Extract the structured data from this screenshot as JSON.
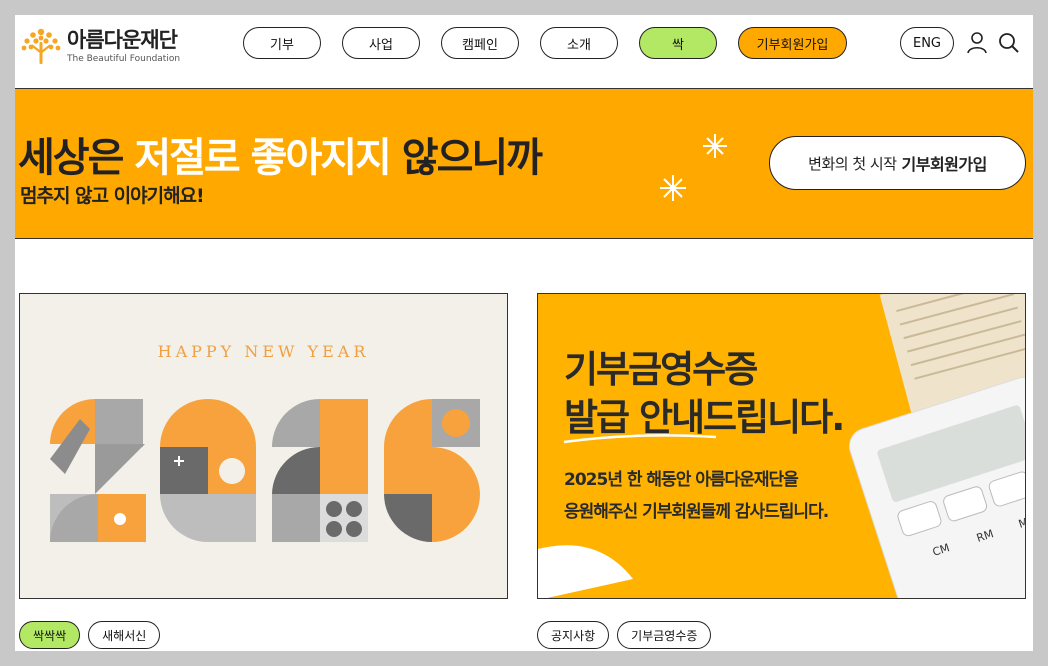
{
  "logo": {
    "name_kr": "아름다운재단",
    "name_en": "The Beautiful Foundation"
  },
  "nav": [
    {
      "label": "기부",
      "style": "plain"
    },
    {
      "label": "사업",
      "style": "plain"
    },
    {
      "label": "캠페인",
      "style": "plain"
    },
    {
      "label": "소개",
      "style": "plain"
    },
    {
      "label": "싹",
      "style": "green"
    },
    {
      "label": "기부회원가입",
      "style": "orange"
    }
  ],
  "utility": {
    "lang_label": "ENG",
    "user_icon": "user-icon",
    "search_icon": "search-icon"
  },
  "banner": {
    "title_part1": "세상은 ",
    "title_highlight": "저절로 좋아지지",
    "title_part2": " 않으니까",
    "subtitle": "멈추지 않고 이야기해요!",
    "cta_prefix": "변화의 첫 시작",
    "cta_strong": "기부회원가입"
  },
  "cards": [
    {
      "image_text": "HAPPY NEW YEAR",
      "tags": [
        "싹싹싹",
        "새해서신"
      ]
    },
    {
      "title_line1": "기부금영수증",
      "title_line2": "발급 안내드립니다.",
      "body_line1": "2025년 한 해동안 아름다운재단을",
      "body_line2": "응원해주신 기부회원들께 감사드립니다.",
      "calc_keys": [
        "CM",
        "RM",
        "M"
      ],
      "tags": [
        "공지사항",
        "기부금영수증"
      ]
    }
  ],
  "colors": {
    "accent_orange": "#ffa800",
    "accent_green": "#b3e864",
    "text": "#222222"
  }
}
